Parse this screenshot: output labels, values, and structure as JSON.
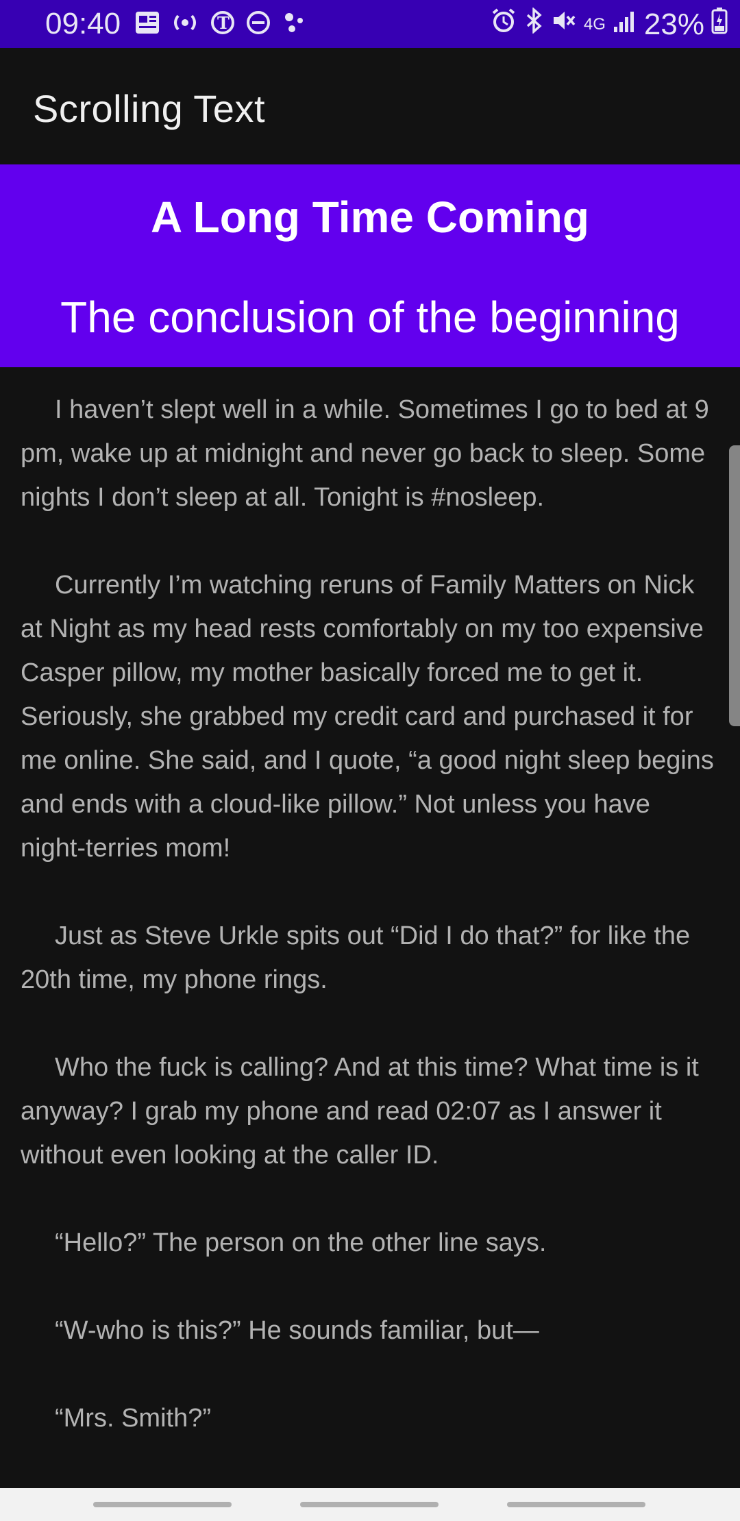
{
  "status_bar": {
    "time": "09:40",
    "battery": "23%",
    "network": "4G",
    "left_icons": [
      "news-icon",
      "radio-waves-icon",
      "nyt-icon",
      "do-not-disturb-icon",
      "dots-icon"
    ],
    "right_icons": [
      "alarm-icon",
      "bluetooth-icon",
      "mute-icon",
      "signal-icon",
      "battery-icon"
    ]
  },
  "app_bar": {
    "title": "Scrolling Text"
  },
  "header": {
    "title": "A Long Time Coming",
    "subtitle": "The conclusion of the beginning",
    "color": "#6200ee"
  },
  "paragraphs": [
    "I haven’t slept well in a while. Sometimes I go to bed at 9 pm, wake up at midnight and never go back to sleep. Some nights I don’t sleep at all. Tonight is #nosleep.",
    "Currently I’m watching reruns of Family Matters on Nick at Night as my head rests comfortably on my too expensive Casper pillow, my mother basically forced me to get it. Seriously, she grabbed my credit card and purchased it for me online. She said, and I quote, “a good night sleep begins and ends with a cloud-like pillow.” Not unless you have night-terries mom!",
    "Just as Steve Urkle spits out “Did I do that?” for like the 20th time, my phone rings.",
    "Who the fuck is calling? And at this time? What time is it anyway? I grab my phone and read 02:07 as I answer it without even looking at the caller ID.",
    "“Hello?” The person on the other line says.",
    "“W-who is this?” He sounds familiar, but—",
    "“Mrs. Smith?”"
  ],
  "colors": {
    "status_bar": "#3700b3",
    "background": "#121212",
    "text": "#b3b3b3"
  }
}
